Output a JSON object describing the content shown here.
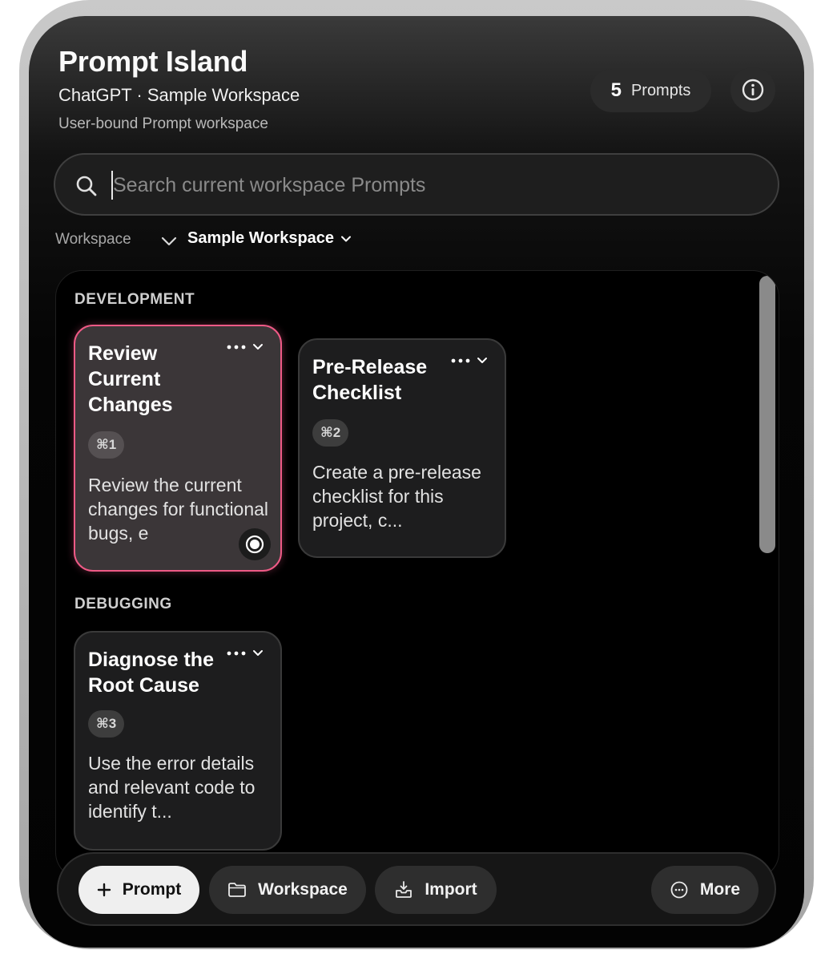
{
  "header": {
    "title": "Prompt Island",
    "subtitle": "ChatGPT · Sample Workspace",
    "description": "User-bound Prompt workspace",
    "prompt_count": "5",
    "prompt_count_label": "Prompts"
  },
  "search": {
    "placeholder": "Search current workspace Prompts",
    "value": ""
  },
  "workspace_selector": {
    "label": "Workspace",
    "selected": "Sample Workspace"
  },
  "sections": [
    {
      "title": "DEVELOPMENT",
      "cards": [
        {
          "title": "Review Current Changes",
          "shortcut": "⌘1",
          "body": "Review the current changes for functional bugs, e",
          "selected": true
        },
        {
          "title": "Pre-Release Checklist",
          "shortcut": "⌘2",
          "body": "Create a pre-release checklist for this project, c...",
          "selected": false
        }
      ]
    },
    {
      "title": "DEBUGGING",
      "cards": [
        {
          "title": "Diagnose the Root Cause",
          "shortcut": "⌘3",
          "body": "Use the error details and relevant code to identify t...",
          "selected": false
        }
      ]
    }
  ],
  "toolbar": {
    "prompt_label": "Prompt",
    "workspace_label": "Workspace",
    "import_label": "Import",
    "more_label": "More"
  },
  "colors": {
    "selected_border": "#ef5a86",
    "panel_bg": "#050505",
    "primary_button_bg": "#efefef"
  },
  "icons": [
    "search-icon",
    "info-icon",
    "chevron-down-icon",
    "more-dots-icon",
    "record-icon",
    "plus-icon",
    "folder-icon",
    "import-icon",
    "more-circle-icon"
  ]
}
